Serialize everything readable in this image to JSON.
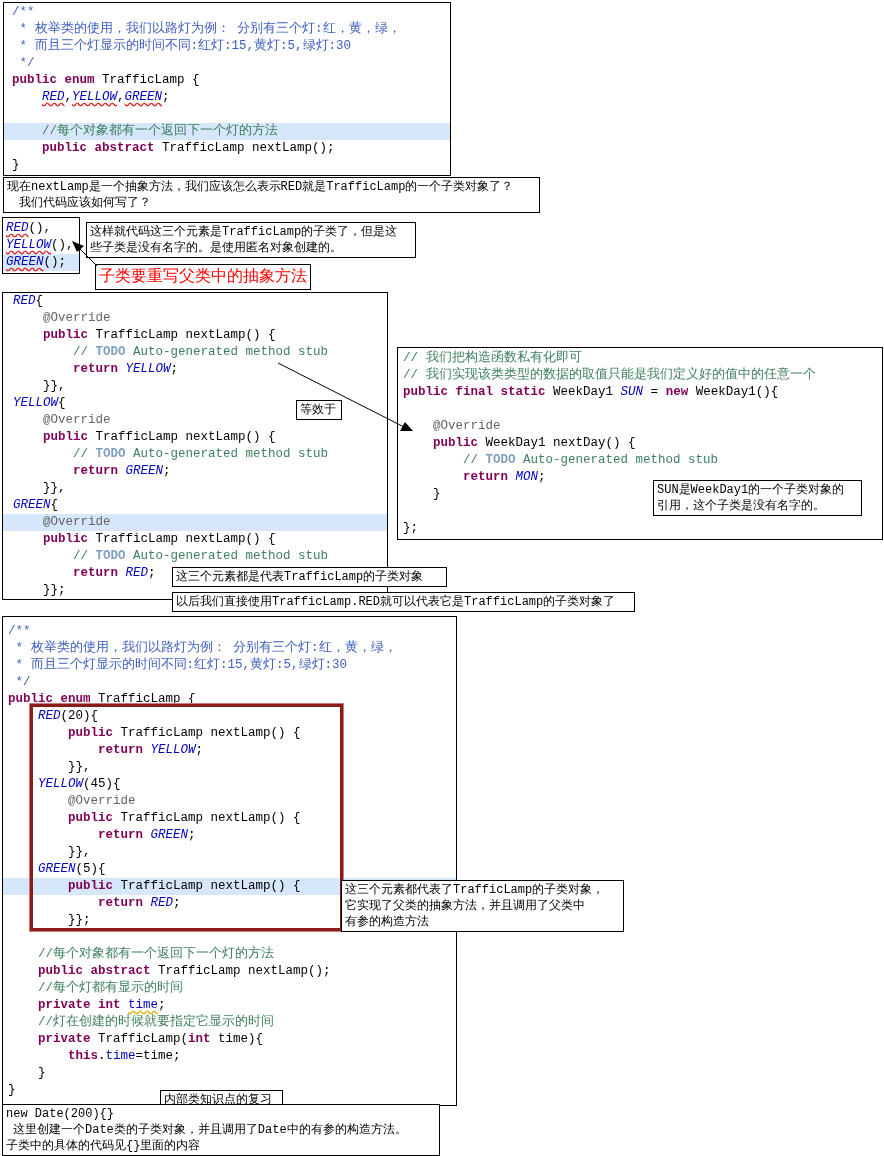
{
  "boxes": [
    {
      "kind": "code",
      "sections": [
        {
          "framed": false,
          "lines": [
            {
              "highlighted": false,
              "tokens": [
                {
                  "kind": "doc",
                  "text": "/**"
                }
              ]
            },
            {
              "highlighted": false,
              "tokens": [
                {
                  "kind": "doc",
                  "text": " * 枚举类的使用，我们以路灯为例： 分别有三个灯:红，黄，绿，"
                }
              ]
            },
            {
              "highlighted": false,
              "tokens": [
                {
                  "kind": "doc",
                  "text": " * 而且三个灯显示的时间不同:红灯:15,黄灯:5,绿灯:30"
                }
              ]
            },
            {
              "highlighted": false,
              "tokens": [
                {
                  "kind": "doc",
                  "text": " */"
                }
              ]
            },
            {
              "highlighted": false,
              "tokens": [
                {
                  "kind": "kw",
                  "text": "public enum"
                },
                {
                  "kind": "plain",
                  "text": " TrafficLamp {"
                }
              ]
            },
            {
              "highlighted": false,
              "tokens": [
                {
                  "kind": "const",
                  "text": "    RED",
                  "error": true
                },
                {
                  "kind": "plain",
                  "text": ","
                },
                {
                  "kind": "const",
                  "text": "YELLOW",
                  "error": true
                },
                {
                  "kind": "plain",
                  "text": ","
                },
                {
                  "kind": "const",
                  "text": "GREEN",
                  "error": true
                },
                {
                  "kind": "plain",
                  "text": ";"
                }
              ]
            },
            {
              "highlighted": false
            },
            {
              "highlighted": true,
              "tokens": [
                {
                  "kind": "comment",
                  "text": "    //每个对象都有一个返回下一个灯的方法"
                }
              ]
            },
            {
              "highlighted": false,
              "tokens": [
                {
                  "kind": "kw",
                  "text": "    public abstract"
                },
                {
                  "kind": "plain",
                  "text": " TrafficLamp nextLamp();"
                }
              ]
            },
            {
              "highlighted": false,
              "tokens": [
                {
                  "kind": "plain",
                  "text": "}"
                }
              ]
            }
          ]
        }
      ]
    },
    {
      "kind": "note",
      "lines": [
        {
          "text": "现在nextLamp是一个抽象方法，我们应该怎么表示RED就是TrafficLamp的一个子类对象了？"
        },
        {
          "text": "我们代码应该如何写了？"
        }
      ]
    },
    {
      "kind": "code",
      "sections": [
        {
          "framed": false,
          "lines": [
            {
              "highlighted": false,
              "tokens": [
                {
                  "kind": "const",
                  "text": "RED",
                  "error": true
                },
                {
                  "kind": "plain",
                  "text": "(),"
                }
              ]
            },
            {
              "highlighted": false,
              "tokens": [
                {
                  "kind": "const",
                  "text": "YELLOW",
                  "error": true
                },
                {
                  "kind": "plain",
                  "text": "(),"
                }
              ]
            },
            {
              "highlighted": true,
              "tokens": [
                {
                  "kind": "const",
                  "text": "GREEN",
                  "error": true
                },
                {
                  "kind": "plain",
                  "text": "();"
                }
              ]
            }
          ]
        }
      ]
    },
    {
      "kind": "note",
      "lines": [
        {
          "text": "这样就代码这三个元素是TrafficLamp的子类了，但是这"
        },
        {
          "text": "些子类是没有名字的。是使用匿名对象创建的。"
        }
      ]
    },
    {
      "kind": "note",
      "lines": [
        {
          "text": "子类要重写父类中的抽象方法",
          "color": "#ff0000"
        }
      ]
    },
    {
      "kind": "code",
      "sections": [
        {
          "framed": false,
          "lines": [
            {
              "highlighted": false,
              "tokens": [
                {
                  "kind": "const",
                  "text": "RED"
                },
                {
                  "kind": "plain",
                  "text": "{"
                }
              ]
            },
            {
              "highlighted": false,
              "tokens": [
                {
                  "kind": "annot",
                  "text": "    @Override"
                }
              ]
            },
            {
              "highlighted": false,
              "tokens": [
                {
                  "kind": "kw",
                  "text": "    public"
                },
                {
                  "kind": "plain",
                  "text": " TrafficLamp nextLamp() {"
                }
              ]
            },
            {
              "highlighted": false,
              "tokens": [
                {
                  "kind": "comment",
                  "text": "        // "
                },
                {
                  "kind": "todo",
                  "text": "TODO"
                },
                {
                  "kind": "comment",
                  "text": " Auto-generated method stub"
                }
              ]
            },
            {
              "highlighted": false,
              "tokens": [
                {
                  "kind": "kw",
                  "text": "        return"
                },
                {
                  "kind": "const",
                  "text": " YELLOW"
                },
                {
                  "kind": "plain",
                  "text": ";"
                }
              ]
            },
            {
              "highlighted": false,
              "tokens": [
                {
                  "kind": "plain",
                  "text": "    }},"
                }
              ]
            },
            {
              "highlighted": false,
              "tokens": [
                {
                  "kind": "const",
                  "text": "YELLOW"
                },
                {
                  "kind": "plain",
                  "text": "{"
                }
              ]
            },
            {
              "highlighted": false,
              "tokens": [
                {
                  "kind": "annot",
                  "text": "    @Override"
                }
              ]
            },
            {
              "highlighted": false,
              "tokens": [
                {
                  "kind": "kw",
                  "text": "    public"
                },
                {
                  "kind": "plain",
                  "text": " TrafficLamp nextLamp() {"
                }
              ]
            },
            {
              "highlighted": false,
              "tokens": [
                {
                  "kind": "comment",
                  "text": "        // "
                },
                {
                  "kind": "todo",
                  "text": "TODO"
                },
                {
                  "kind": "comment",
                  "text": " Auto-generated method stub"
                }
              ]
            },
            {
              "highlighted": false,
              "tokens": [
                {
                  "kind": "kw",
                  "text": "        return"
                },
                {
                  "kind": "const",
                  "text": " GREEN"
                },
                {
                  "kind": "plain",
                  "text": ";"
                }
              ]
            },
            {
              "highlighted": false,
              "tokens": [
                {
                  "kind": "plain",
                  "text": "    }},"
                }
              ]
            },
            {
              "highlighted": false,
              "tokens": [
                {
                  "kind": "const",
                  "text": "GREEN"
                },
                {
                  "kind": "plain",
                  "text": "{"
                }
              ]
            },
            {
              "highlighted": true,
              "tokens": [
                {
                  "kind": "annot",
                  "text": "    @Override"
                }
              ]
            },
            {
              "highlighted": false,
              "tokens": [
                {
                  "kind": "kw",
                  "text": "    public"
                },
                {
                  "kind": "plain",
                  "text": " TrafficLamp nextLamp() {"
                }
              ]
            },
            {
              "highlighted": false,
              "tokens": [
                {
                  "kind": "comment",
                  "text": "        // "
                },
                {
                  "kind": "todo",
                  "text": "TODO"
                },
                {
                  "kind": "comment",
                  "text": " Auto-generated method stub"
                }
              ]
            },
            {
              "highlighted": false,
              "tokens": [
                {
                  "kind": "kw",
                  "text": "        return"
                },
                {
                  "kind": "const",
                  "text": " RED"
                },
                {
                  "kind": "plain",
                  "text": ";"
                }
              ]
            },
            {
              "highlighted": false,
              "tokens": [
                {
                  "kind": "plain",
                  "text": "    }};"
                }
              ]
            }
          ]
        }
      ]
    },
    {
      "kind": "note",
      "lines": [
        {
          "text": "等效于"
        }
      ]
    },
    {
      "kind": "code",
      "sections": [
        {
          "framed": false,
          "lines": [
            {
              "highlighted": false,
              "tokens": [
                {
                  "kind": "comment",
                  "text": "// 我们把构造函数私有化即可"
                }
              ]
            },
            {
              "highlighted": false,
              "tokens": [
                {
                  "kind": "comment",
                  "text": "// 我们实现该类类型的数据的取值只能是我们定义好的值中的任意一个"
                }
              ]
            },
            {
              "highlighted": false,
              "tokens": [
                {
                  "kind": "kw",
                  "text": "public final static"
                },
                {
                  "kind": "plain",
                  "text": " WeekDay1 "
                },
                {
                  "kind": "const",
                  "text": "SUN"
                },
                {
                  "kind": "plain",
                  "text": " = "
                },
                {
                  "kind": "kw",
                  "text": "new"
                },
                {
                  "kind": "plain",
                  "text": " WeekDay1(){"
                }
              ]
            },
            {
              "highlighted": false
            },
            {
              "highlighted": false,
              "tokens": [
                {
                  "kind": "annot",
                  "text": "    @Override"
                }
              ]
            },
            {
              "highlighted": false,
              "tokens": [
                {
                  "kind": "kw",
                  "text": "    public"
                },
                {
                  "kind": "plain",
                  "text": " WeekDay1 nextDay() {"
                }
              ]
            },
            {
              "highlighted": false,
              "tokens": [
                {
                  "kind": "comment",
                  "text": "        // "
                },
                {
                  "kind": "todo",
                  "text": "TODO"
                },
                {
                  "kind": "comment",
                  "text": " Auto-generated method stub"
                }
              ]
            },
            {
              "highlighted": false,
              "tokens": [
                {
                  "kind": "kw",
                  "text": "        return"
                },
                {
                  "kind": "const",
                  "text": " MON"
                },
                {
                  "kind": "plain",
                  "text": ";"
                }
              ]
            },
            {
              "highlighted": false,
              "tokens": [
                {
                  "kind": "plain",
                  "text": "    }"
                }
              ]
            },
            {
              "highlighted": false
            },
            {
              "highlighted": false,
              "tokens": [
                {
                  "kind": "plain",
                  "text": "};"
                }
              ]
            }
          ]
        }
      ]
    },
    {
      "kind": "note",
      "lines": [
        {
          "text": "SUN是WeekDay1的一个子类对象的"
        },
        {
          "text": "引用，这个子类是没有名字的。"
        }
      ]
    },
    {
      "kind": "note",
      "lines": [
        {
          "text": "这三个元素都是代表TrafficLamp的子类对象"
        }
      ]
    },
    {
      "kind": "note",
      "lines": [
        {
          "text": "以后我们直接使用TrafficLamp.RED就可以代表它是TrafficLamp的子类对象了"
        }
      ]
    },
    {
      "kind": "code",
      "sections": [
        {
          "framed": false,
          "lines": [
            {
              "highlighted": false,
              "tokens": [
                {
                  "kind": "doc",
                  "text": "/**"
                }
              ]
            },
            {
              "highlighted": false,
              "tokens": [
                {
                  "kind": "doc",
                  "text": " * 枚举类的使用，我们以路灯为例： 分别有三个灯:红，黄，绿，"
                }
              ]
            },
            {
              "highlighted": false,
              "tokens": [
                {
                  "kind": "doc",
                  "text": " * 而且三个灯显示的时间不同:红灯:15,黄灯:5,绿灯:30"
                }
              ]
            },
            {
              "highlighted": false,
              "tokens": [
                {
                  "kind": "doc",
                  "text": " */"
                }
              ]
            },
            {
              "highlighted": false,
              "tokens": [
                {
                  "kind": "kw",
                  "text": "public enum"
                },
                {
                  "kind": "plain",
                  "text": " TrafficLamp {"
                }
              ]
            }
          ]
        },
        {
          "framed": true,
          "lines": [
            {
              "highlighted": false,
              "tokens": [
                {
                  "kind": "const",
                  "text": "    RED"
                },
                {
                  "kind": "plain",
                  "text": "(20){"
                }
              ]
            },
            {
              "highlighted": false,
              "tokens": [
                {
                  "kind": "kw",
                  "text": "        public"
                },
                {
                  "kind": "plain",
                  "text": " TrafficLamp nextLamp() {"
                }
              ]
            },
            {
              "highlighted": false,
              "tokens": [
                {
                  "kind": "kw",
                  "text": "            return"
                },
                {
                  "kind": "const",
                  "text": " YELLOW"
                },
                {
                  "kind": "plain",
                  "text": ";"
                }
              ]
            },
            {
              "highlighted": false,
              "tokens": [
                {
                  "kind": "plain",
                  "text": "        }},"
                }
              ]
            },
            {
              "highlighted": false,
              "tokens": [
                {
                  "kind": "const",
                  "text": "    YELLOW"
                },
                {
                  "kind": "plain",
                  "text": "(45){"
                }
              ]
            },
            {
              "highlighted": false,
              "tokens": [
                {
                  "kind": "annot",
                  "text": "        @Override"
                }
              ]
            },
            {
              "highlighted": false,
              "tokens": [
                {
                  "kind": "kw",
                  "text": "        public"
                },
                {
                  "kind": "plain",
                  "text": " TrafficLamp nextLamp() {"
                }
              ]
            },
            {
              "highlighted": false,
              "tokens": [
                {
                  "kind": "kw",
                  "text": "            return"
                },
                {
                  "kind": "const",
                  "text": " GREEN"
                },
                {
                  "kind": "plain",
                  "text": ";"
                }
              ]
            },
            {
              "highlighted": false,
              "tokens": [
                {
                  "kind": "plain",
                  "text": "        }},"
                }
              ]
            },
            {
              "highlighted": false,
              "tokens": [
                {
                  "kind": "const",
                  "text": "    GREEN"
                },
                {
                  "kind": "plain",
                  "text": "(5){"
                }
              ]
            },
            {
              "highlighted": true,
              "tokens": [
                {
                  "kind": "kw",
                  "text": "        public"
                },
                {
                  "kind": "plain",
                  "text": " TrafficLamp nextLamp() {"
                }
              ]
            },
            {
              "highlighted": false,
              "tokens": [
                {
                  "kind": "kw",
                  "text": "            return"
                },
                {
                  "kind": "const",
                  "text": " RED"
                },
                {
                  "kind": "plain",
                  "text": ";"
                }
              ]
            },
            {
              "highlighted": false,
              "tokens": [
                {
                  "kind": "plain",
                  "text": "        }};"
                }
              ]
            }
          ]
        },
        {
          "framed": false,
          "lines": [
            {
              "highlighted": false
            },
            {
              "highlighted": false,
              "tokens": [
                {
                  "kind": "comment",
                  "text": "    //每个对象都有一个返回下一个灯的方法"
                }
              ]
            },
            {
              "highlighted": false,
              "tokens": [
                {
                  "kind": "kw",
                  "text": "    public abstract"
                },
                {
                  "kind": "plain",
                  "text": " TrafficLamp nextLamp();"
                }
              ]
            },
            {
              "highlighted": false,
              "tokens": [
                {
                  "kind": "comment",
                  "text": "    //每个灯都有显示的时间"
                }
              ]
            },
            {
              "highlighted": false,
              "tokens": [
                {
                  "kind": "kw",
                  "text": "    private int"
                },
                {
                  "kind": "field",
                  "text": " time",
                  "warning": true
                },
                {
                  "kind": "plain",
                  "text": ";"
                }
              ]
            },
            {
              "highlighted": false,
              "tokens": [
                {
                  "kind": "comment",
                  "text": "    //灯在创建的时候就要指定它显示的时间"
                }
              ]
            },
            {
              "highlighted": false,
              "tokens": [
                {
                  "kind": "kw",
                  "text": "    private"
                },
                {
                  "kind": "plain",
                  "text": " TrafficLamp("
                },
                {
                  "kind": "kw",
                  "text": "int"
                },
                {
                  "kind": "plain",
                  "text": " time){"
                }
              ]
            },
            {
              "highlighted": false,
              "tokens": [
                {
                  "kind": "kw",
                  "text": "        this"
                },
                {
                  "kind": "plain",
                  "text": "."
                },
                {
                  "kind": "field",
                  "text": "time"
                },
                {
                  "kind": "plain",
                  "text": "=time;"
                }
              ]
            },
            {
              "highlighted": false,
              "tokens": [
                {
                  "kind": "plain",
                  "text": "    }"
                }
              ]
            },
            {
              "highlighted": false,
              "tokens": [
                {
                  "kind": "plain",
                  "text": "}"
                }
              ]
            }
          ]
        }
      ]
    },
    {
      "kind": "note",
      "lines": [
        {
          "text": "这三个元素都代表了TrafficLamp的子类对象，"
        },
        {
          "text": "它实现了父类的抽象方法，并且调用了父类中"
        },
        {
          "text": "有参的构造方法"
        }
      ]
    },
    {
      "kind": "note",
      "lines": [
        {
          "text": "内部类知识点的复习"
        }
      ]
    },
    {
      "kind": "note",
      "lines": [
        {
          "text": "new Date(200){}"
        },
        {
          "text": "这里创建一个Date类的子类对象，并且调用了Date中的有参的构造方法。"
        },
        {
          "text": "子类中的具体的代码见{}里面的内容"
        }
      ]
    }
  ]
}
